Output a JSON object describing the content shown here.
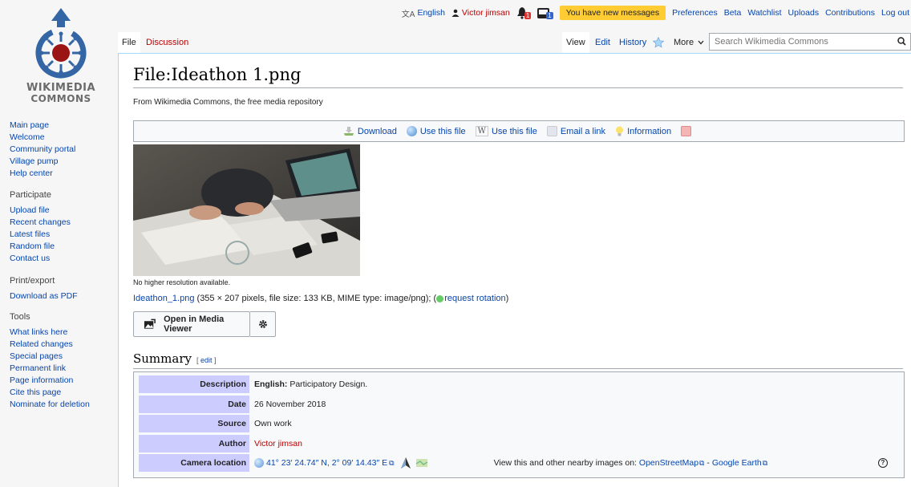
{
  "personal": {
    "language": "English",
    "user": "Victor jimsan",
    "alert_count": "1",
    "notice_count": "1",
    "messages": "You have new messages",
    "links": [
      "Preferences",
      "Beta",
      "Watchlist",
      "Uploads",
      "Contributions",
      "Log out"
    ]
  },
  "logo": {
    "line1": "WIKIMEDIA",
    "line2": "COMMONS"
  },
  "sidebar": {
    "nav": [
      "Main page",
      "Welcome",
      "Community portal",
      "Village pump",
      "Help center"
    ],
    "participate": {
      "heading": "Participate",
      "items": [
        "Upload file",
        "Recent changes",
        "Latest files",
        "Random file",
        "Contact us"
      ]
    },
    "print": {
      "heading": "Print/export",
      "items": [
        "Download as PDF"
      ]
    },
    "tools": {
      "heading": "Tools",
      "items": [
        "What links here",
        "Related changes",
        "Special pages",
        "Permanent link",
        "Page information",
        "Cite this page",
        "Nominate for deletion"
      ]
    }
  },
  "tabs": {
    "file": "File",
    "discussion": "Discussion",
    "view": "View",
    "edit": "Edit",
    "history": "History",
    "more": "More"
  },
  "search": {
    "placeholder": "Search Wikimedia Commons"
  },
  "page": {
    "title": "File:Ideathon 1.png",
    "subtitle": "From Wikimedia Commons, the free media repository"
  },
  "filetoc": {
    "download": "Download",
    "use1": "Use this file",
    "use2": "Use this file",
    "email": "Email a link",
    "information": "Information"
  },
  "file": {
    "no_higher": "No higher resolution available.",
    "name": "Ideathon_1.png",
    "meta_open": " (355 × 207 pixels, file size: 133 KB, MIME type: image/png); (",
    "rotation": "request rotation",
    "meta_close": ")"
  },
  "viewer": {
    "label": "Open in Media Viewer"
  },
  "summary": {
    "heading": "Summary",
    "edit_open": "[ ",
    "edit": "edit",
    "edit_close": " ]",
    "description_label": "Description",
    "description_lang": "English:",
    "description": " Participatory Design.",
    "date_label": "Date",
    "date": "26 November 2018",
    "source_label": "Source",
    "source": "Own work",
    "author_label": "Author",
    "author": "Victor jimsan",
    "camera_label": "Camera location",
    "coords": "41° 23′ 24.74″ N, 2° 09′ 14.43″ E",
    "nearby_text": "View this and other nearby images on: ",
    "osm": "OpenStreetMap",
    "sep": " - ",
    "google": "Google Earth"
  }
}
